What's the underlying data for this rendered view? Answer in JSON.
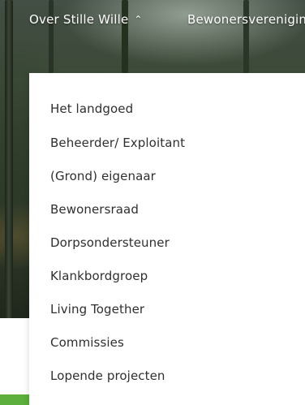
{
  "nav": {
    "items": [
      {
        "label": "Over Stille Wille",
        "expanded": true,
        "chevron": "chevron-up-icon"
      },
      {
        "label": "Bewonersvereniging"
      }
    ]
  },
  "dropdown": {
    "items": [
      {
        "label": "Het landgoed"
      },
      {
        "label": "Beheerder/ Exploitant"
      },
      {
        "label": "(Grond) eigenaar"
      },
      {
        "label": "Bewonersraad"
      },
      {
        "label": "Dorpsondersteuner"
      },
      {
        "label": "Klankbordgroep"
      },
      {
        "label": "Living Together"
      },
      {
        "label": "Commissies"
      },
      {
        "label": "Lopende projecten"
      }
    ]
  },
  "colors": {
    "accent_green": "#5cae3d",
    "menu_text": "#2f2f2f",
    "nav_text": "#ffffff"
  }
}
